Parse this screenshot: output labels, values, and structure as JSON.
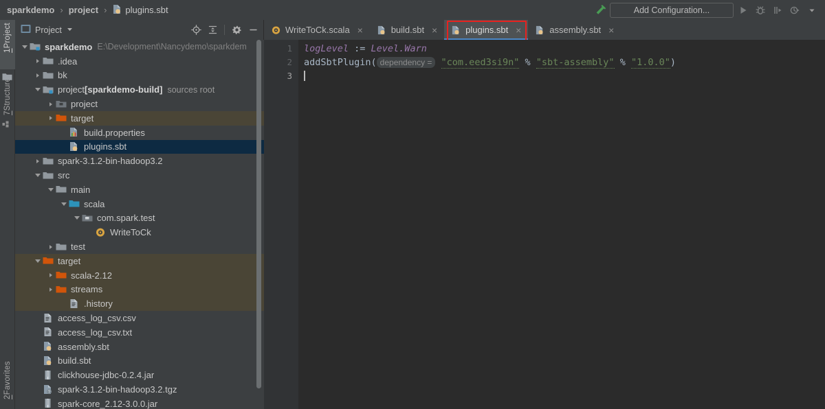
{
  "window": {
    "breadcrumb": [
      {
        "label": "sparkdemo",
        "icon": "none",
        "bold": true
      },
      {
        "label": "project",
        "icon": "none",
        "bold": true
      },
      {
        "label": "plugins.sbt",
        "icon": "sbt-file-icon",
        "bold": false
      }
    ],
    "separator": "›"
  },
  "toolbar": {
    "build_icon": "hammer-icon",
    "add_configuration_label": "Add Configuration...",
    "run_icon": "run-icon",
    "debug_icon": "debug-icon",
    "run_coverage_icon": "run-with-coverage-icon",
    "profiler_icon": "profiler-icon",
    "dropdown_icon": "chevron-down-icon"
  },
  "left_strip": {
    "tabs": [
      {
        "number": "1",
        "label": "Project",
        "active": true
      },
      {
        "number": "7",
        "label": "Structure",
        "active": false
      },
      {
        "number": "2",
        "label": "Favorites",
        "active": false
      }
    ]
  },
  "project_panel": {
    "title": "Project",
    "title_icon": "project-view-icon",
    "dropdown_icon": "chevron-down-icon",
    "tools": [
      {
        "name": "locate-icon"
      },
      {
        "name": "collapse-all-icon"
      },
      {
        "name": "settings-gear-icon"
      },
      {
        "name": "hide-panel-icon"
      }
    ],
    "tree": [
      {
        "depth": 0,
        "arrow": "open",
        "icon": "module-folder-icon",
        "label": "sparkdemo",
        "bold": true,
        "suffix": "E:\\Development\\Nancydemo\\sparkdem",
        "suffix_style": "path",
        "state": "none"
      },
      {
        "depth": 1,
        "arrow": "closed",
        "icon": "folder-icon",
        "label": ".idea",
        "bold": false,
        "suffix": "",
        "suffix_style": "",
        "state": "none"
      },
      {
        "depth": 1,
        "arrow": "closed",
        "icon": "folder-icon",
        "label": "bk",
        "bold": false,
        "suffix": "",
        "suffix_style": "",
        "state": "none"
      },
      {
        "depth": 1,
        "arrow": "open",
        "icon": "module-folder-icon",
        "label": "project [sparkdemo-build]",
        "bold": false,
        "suffix": "sources root",
        "suffix_style": "note",
        "state": "none"
      },
      {
        "depth": 2,
        "arrow": "closed",
        "icon": "excluded-folder-icon",
        "label": "project",
        "bold": false,
        "suffix": "",
        "suffix_style": "",
        "state": "none"
      },
      {
        "depth": 2,
        "arrow": "closed",
        "icon": "orange-folder-icon",
        "label": "target",
        "bold": false,
        "suffix": "",
        "suffix_style": "",
        "state": "highlight"
      },
      {
        "depth": 3,
        "arrow": "none",
        "icon": "properties-file-icon",
        "label": "build.properties",
        "bold": false,
        "suffix": "",
        "suffix_style": "",
        "state": "none"
      },
      {
        "depth": 3,
        "arrow": "none",
        "icon": "sbt-file-icon",
        "label": "plugins.sbt",
        "bold": false,
        "suffix": "",
        "suffix_style": "",
        "state": "selected"
      },
      {
        "depth": 1,
        "arrow": "closed",
        "icon": "folder-icon",
        "label": "spark-3.1.2-bin-hadoop3.2",
        "bold": false,
        "suffix": "",
        "suffix_style": "",
        "state": "none"
      },
      {
        "depth": 1,
        "arrow": "open",
        "icon": "folder-icon",
        "label": "src",
        "bold": false,
        "suffix": "",
        "suffix_style": "",
        "state": "none"
      },
      {
        "depth": 2,
        "arrow": "open",
        "icon": "folder-icon",
        "label": "main",
        "bold": false,
        "suffix": "",
        "suffix_style": "",
        "state": "none"
      },
      {
        "depth": 3,
        "arrow": "open",
        "icon": "sources-folder-icon",
        "label": "scala",
        "bold": false,
        "suffix": "",
        "suffix_style": "",
        "state": "none"
      },
      {
        "depth": 4,
        "arrow": "open",
        "icon": "package-icon",
        "label": "com.spark.test",
        "bold": false,
        "suffix": "",
        "suffix_style": "",
        "state": "none"
      },
      {
        "depth": 5,
        "arrow": "none",
        "icon": "scala-object-icon",
        "label": "WriteToCk",
        "bold": false,
        "suffix": "",
        "suffix_style": "",
        "state": "none"
      },
      {
        "depth": 2,
        "arrow": "closed",
        "icon": "folder-icon",
        "label": "test",
        "bold": false,
        "suffix": "",
        "suffix_style": "",
        "state": "none"
      },
      {
        "depth": 1,
        "arrow": "open",
        "icon": "orange-folder-icon",
        "label": "target",
        "bold": false,
        "suffix": "",
        "suffix_style": "",
        "state": "highlight"
      },
      {
        "depth": 2,
        "arrow": "closed",
        "icon": "orange-folder-icon",
        "label": "scala-2.12",
        "bold": false,
        "suffix": "",
        "suffix_style": "",
        "state": "highlight"
      },
      {
        "depth": 2,
        "arrow": "closed",
        "icon": "orange-folder-icon",
        "label": "streams",
        "bold": false,
        "suffix": "",
        "suffix_style": "",
        "state": "highlight"
      },
      {
        "depth": 3,
        "arrow": "none",
        "icon": "text-file-icon",
        "label": ".history",
        "bold": false,
        "suffix": "",
        "suffix_style": "",
        "state": "highlight"
      },
      {
        "depth": 1,
        "arrow": "none",
        "icon": "text-file-icon",
        "label": "access_log_csv.csv",
        "bold": false,
        "suffix": "",
        "suffix_style": "",
        "state": "none"
      },
      {
        "depth": 1,
        "arrow": "none",
        "icon": "text-file-icon",
        "label": "access_log_csv.txt",
        "bold": false,
        "suffix": "",
        "suffix_style": "",
        "state": "none"
      },
      {
        "depth": 1,
        "arrow": "none",
        "icon": "sbt-file-icon",
        "label": "assembly.sbt",
        "bold": false,
        "suffix": "",
        "suffix_style": "",
        "state": "none"
      },
      {
        "depth": 1,
        "arrow": "none",
        "icon": "sbt-file-icon",
        "label": "build.sbt",
        "bold": false,
        "suffix": "",
        "suffix_style": "",
        "state": "none"
      },
      {
        "depth": 1,
        "arrow": "none",
        "icon": "jar-file-icon",
        "label": "clickhouse-jdbc-0.2.4.jar",
        "bold": false,
        "suffix": "",
        "suffix_style": "",
        "state": "none"
      },
      {
        "depth": 1,
        "arrow": "none",
        "icon": "unknown-file-icon",
        "label": "spark-3.1.2-bin-hadoop3.2.tgz",
        "bold": false,
        "suffix": "",
        "suffix_style": "",
        "state": "none"
      },
      {
        "depth": 1,
        "arrow": "none",
        "icon": "jar-file-icon",
        "label": "spark-core_2.12-3.0.0.jar",
        "bold": false,
        "suffix": "",
        "suffix_style": "",
        "state": "none"
      }
    ]
  },
  "editor": {
    "tabs": [
      {
        "label": "WriteToCk.scala",
        "icon": "scala-object-icon",
        "active": false,
        "close_icon": "×"
      },
      {
        "label": "build.sbt",
        "icon": "sbt-file-icon",
        "active": false,
        "close_icon": "×"
      },
      {
        "label": "plugins.sbt",
        "icon": "sbt-file-icon",
        "active": true,
        "close_icon": "×"
      },
      {
        "label": "assembly.sbt",
        "icon": "sbt-file-icon",
        "active": false,
        "close_icon": "×"
      }
    ],
    "annotation_color": "#e8221f",
    "line_numbers": [
      "1",
      "2",
      "3"
    ],
    "current_line": 3,
    "code": {
      "line1": {
        "ident": "logLevel",
        "assign": " := ",
        "value": "Level.Warn"
      },
      "line2": {
        "call": "addSbtPlugin(",
        "hint": "dependency =",
        "arg1": "\"com.eed3si9n\"",
        "op1": "%",
        "arg2": "\"sbt-assembly\"",
        "op2": "%",
        "arg3": "\"1.0.0\"",
        "close": ")"
      }
    }
  },
  "colors": {
    "background": "#3c3f41",
    "editor_background": "#2b2b2b",
    "selection": "#0d2a42",
    "highlight": "#4a4536",
    "string": "#6a8759",
    "keyword_italic": "#9876aa",
    "tab_underline": "#4a88c7",
    "annotation_red": "#e8221f"
  }
}
